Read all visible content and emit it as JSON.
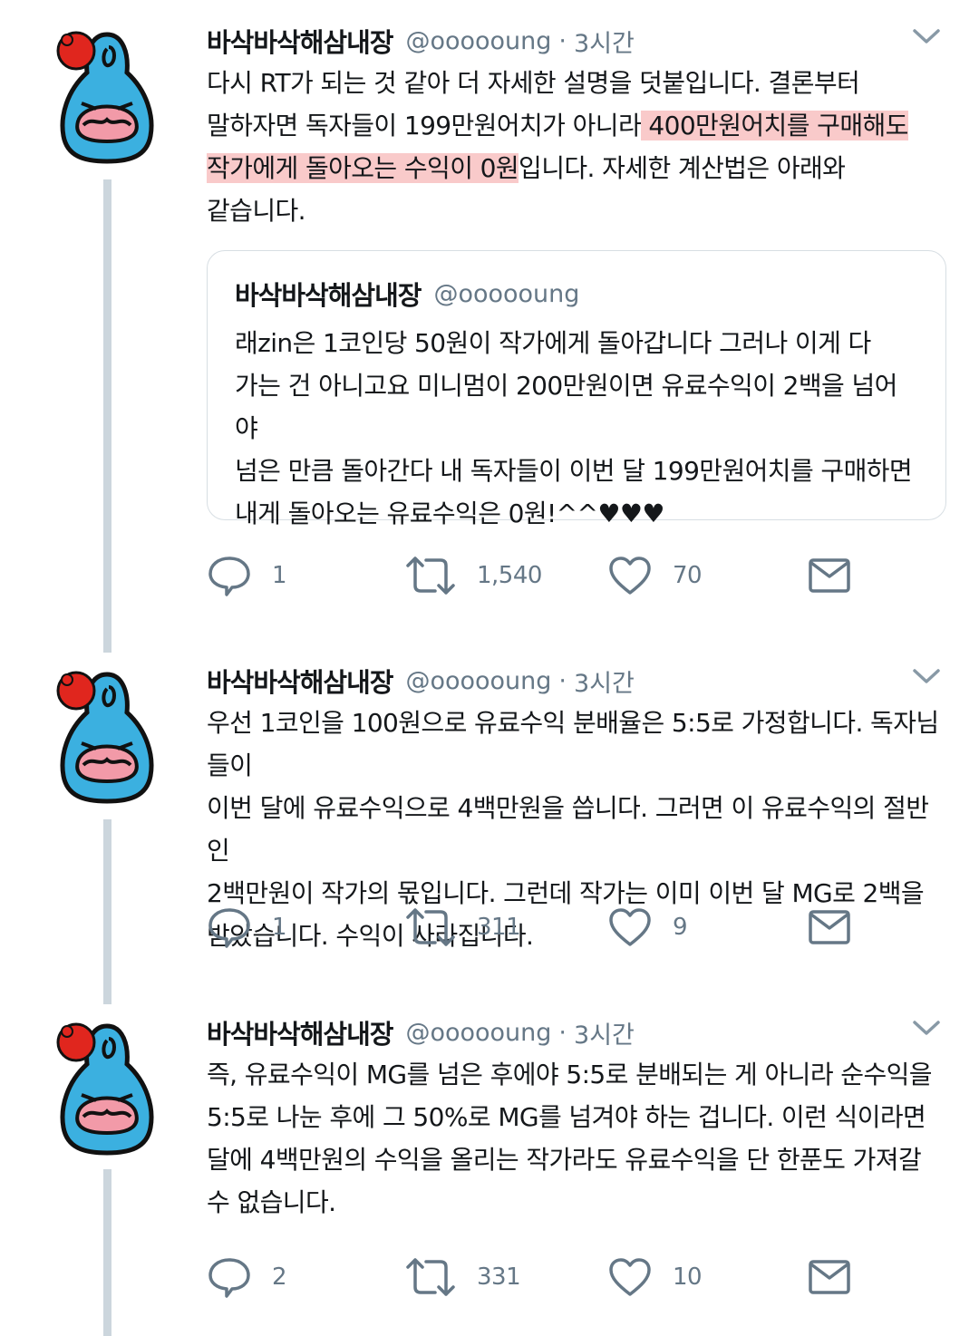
{
  "colors": {
    "accent_highlight": "#f08080",
    "muted": "#657786",
    "thread_line": "#ccd6dd",
    "text": "#14171a"
  },
  "tweets": [
    {
      "name": "바삭바삭해삼내장",
      "handle": "@oooooung",
      "dot": "·",
      "time": "3시간",
      "text_before": "다시 RT가 되는 것 같아 더 자세한 설명을 덧붙입니다. 결론부터\n말하자면 독자들이 199만원어치가 아니라",
      "text_highlight": " 400만원어치를 구매해도\n작가에게 돌아오는 수익이 0원",
      "text_after": "입니다. 자세한 계산법은 아래와\n같습니다.",
      "quote": {
        "name": "바삭바삭해삼내장",
        "handle": "@oooooung",
        "text": "래zin은 1코인당 50원이 작가에게 돌아갑니다 그러나 이게 다\n가는 건 아니고요 미니멈이 200만원이면 유료수익이 2백을 넘어야\n넘은 만큼 돌아간다 내 독자들이 이번 달 199만원어치를 구매하면\n내게 돌아오는 유료수익은 0원!^^♥♥♥"
      },
      "reply_count": "1",
      "retweet_count": "1,540",
      "like_count": "70"
    },
    {
      "name": "바삭바삭해삼내장",
      "handle": "@oooooung",
      "dot": "·",
      "time": "3시간",
      "text": "우선 1코인을 100원으로 유료수익 분배율은 5:5로 가정합니다. 독자님들이\n이번 달에 유료수익으로 4백만원을 씁니다. 그러면 이 유료수익의 절반인\n2백만원이 작가의 몫입니다. 그런데 작가는 이미 이번 달 MG로 2백을\n받았습니다. 수익이 사라집니다.",
      "reply_count": "1",
      "retweet_count": "311",
      "like_count": "9"
    },
    {
      "name": "바삭바삭해삼내장",
      "handle": "@oooooung",
      "dot": "·",
      "time": "3시간",
      "text": "즉, 유료수익이 MG를 넘은 후에야 5:5로 분배되는 게 아니라 순수익을\n5:5로 나눈 후에 그 50%로 MG를 넘겨야 하는 겁니다. 이런 식이라면\n달에 4백만원의 수익을 올리는 작가라도 유료수익을 단 한푼도 가져갈\n수 없습니다.",
      "reply_count": "2",
      "retweet_count": "331",
      "like_count": "10"
    }
  ]
}
